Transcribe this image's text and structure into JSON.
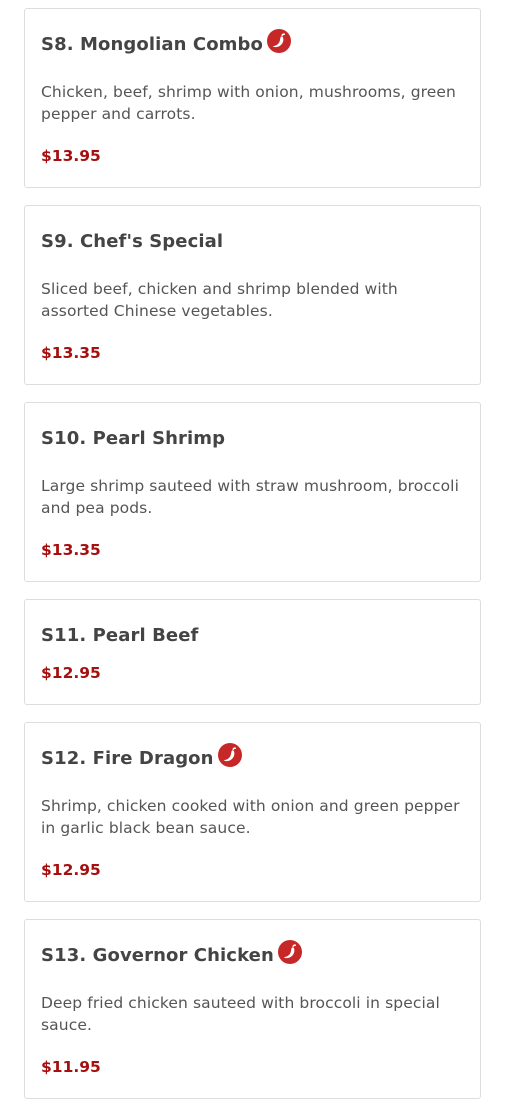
{
  "colors": {
    "price": "#a50f0f",
    "spicy_icon": "#c62828",
    "card_border": "#dddddd",
    "title": "#444444"
  },
  "items": [
    {
      "title": "S8. Mongolian Combo",
      "spicy": true,
      "icon": "spicy-pepper-icon",
      "description": "Chicken, beef, shrimp with onion, mushrooms, green pepper and carrots.",
      "price": "$13.95"
    },
    {
      "title": "S9. Chef's Special",
      "spicy": false,
      "description": "Sliced beef, chicken and shrimp blended with assorted Chinese vegetables.",
      "price": "$13.35"
    },
    {
      "title": "S10. Pearl Shrimp",
      "spicy": false,
      "description": "Large shrimp sauteed with straw mushroom, broccoli and pea pods.",
      "price": "$13.35"
    },
    {
      "title": "S11. Pearl Beef",
      "spicy": false,
      "price": "$12.95"
    },
    {
      "title": "S12. Fire Dragon",
      "spicy": true,
      "icon": "spicy-pepper-icon",
      "description": "Shrimp, chicken cooked with onion and green pepper in garlic black bean sauce.",
      "price": "$12.95"
    },
    {
      "title": "S13. Governor Chicken",
      "spicy": true,
      "icon": "spicy-pepper-icon",
      "description": "Deep fried chicken sauteed with broccoli in special sauce.",
      "price": "$11.95"
    }
  ]
}
